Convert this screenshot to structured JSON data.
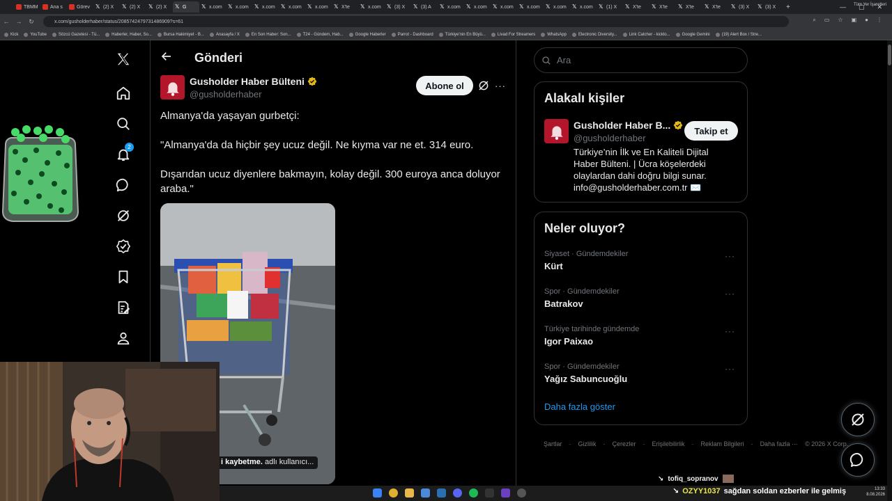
{
  "browser": {
    "tabs": [
      {
        "label": "TBMM",
        "fav": "red"
      },
      {
        "label": "Ana s",
        "fav": "red"
      },
      {
        "label": "Görev",
        "fav": "red"
      },
      {
        "label": "(2) X",
        "fav": "x"
      },
      {
        "label": "(2) X",
        "fav": "x"
      },
      {
        "label": "(2) X",
        "fav": "x"
      },
      {
        "label": "G",
        "fav": "x",
        "active": true
      },
      {
        "label": "x.com",
        "fav": "x"
      },
      {
        "label": "x.com",
        "fav": "x"
      },
      {
        "label": "x.com",
        "fav": "x"
      },
      {
        "label": "x.com",
        "fav": "x"
      },
      {
        "label": "x.com",
        "fav": "x"
      },
      {
        "label": "X'te",
        "fav": "x"
      },
      {
        "label": "x.com",
        "fav": "x"
      },
      {
        "label": "(3) X",
        "fav": "x"
      },
      {
        "label": "(3) A",
        "fav": "x"
      },
      {
        "label": "x.com",
        "fav": "x"
      },
      {
        "label": "x.com",
        "fav": "x"
      },
      {
        "label": "x.com",
        "fav": "x"
      },
      {
        "label": "x.com",
        "fav": "x"
      },
      {
        "label": "x.com",
        "fav": "x"
      },
      {
        "label": "x.com",
        "fav": "x"
      },
      {
        "label": "(1) X",
        "fav": "x"
      },
      {
        "label": "X'te",
        "fav": "x"
      },
      {
        "label": "X'te",
        "fav": "x"
      },
      {
        "label": "X'te",
        "fav": "x"
      },
      {
        "label": "X'te",
        "fav": "x"
      },
      {
        "label": "(3) X",
        "fav": "x"
      },
      {
        "label": "(3) X",
        "fav": "x"
      }
    ],
    "new_tab": "+",
    "url": "x.com/gusholderhaber/status/2085742479731486909?s=61",
    "bookmarks": [
      "Kick",
      "YouTube",
      "Sözcü Gazetesi - Tü...",
      "Haberler, Haber, So...",
      "Bursa Hakimiyet - B...",
      "Anasayfa / X",
      "En Son Haber: Son...",
      "T24 - Gündem, Hab...",
      "Google Haberler",
      "Parrot - Dashboard",
      "Türkiye'nin En Büyü...",
      "Livad For Streamers",
      "WhatsApp",
      "Electronic Diversity...",
      "Link Catcher - kicklo...",
      "Google Gemini",
      "(19) Alert Box / Stre..."
    ],
    "bookmarks_other": "Tüm Yer İşaretleri"
  },
  "nav": {
    "notifications_badge": "2"
  },
  "header": {
    "title": "Gönderi"
  },
  "tweet": {
    "author_name": "Gusholder Haber Bülteni",
    "author_handle": "@gusholderhaber",
    "subscribe_label": "Abone ol",
    "paragraphs": [
      "Almanya'da yaşayan gurbetçi:",
      "\"Almanya'da da hiçbir şey ucuz değil. Ne kıyma var ne et. 314 euro.",
      "Dışarıdan ucuz diyenlere bakmayın, kolay değil. 300 euroya anca doluyor araba.\""
    ],
    "media_caption_bold": "i kaybetme.",
    "media_caption_rest": " adlı kullanıcı..."
  },
  "search": {
    "placeholder": "Ara"
  },
  "related": {
    "title": "Alakalı kişiler",
    "name": "Gusholder Haber B...",
    "handle": "@gusholderhaber",
    "follow_label": "Takip et",
    "bio": "Türkiye’nin İlk ve En Kaliteli Dijital Haber Bülteni. | Ücra köşelerdeki olaylardan dahi doğru bilgi sunar. info@gusholderhaber.com.tr ✉️"
  },
  "trends": {
    "title": "Neler oluyor?",
    "items": [
      {
        "context": "Siyaset · Gündemdekiler",
        "name": "Kürt"
      },
      {
        "context": "Spor · Gündemdekiler",
        "name": "Batrakov"
      },
      {
        "context": "Türkiye tarihinde gündemde",
        "name": "Igor Paixao"
      },
      {
        "context": "Spor · Gündemdekiler",
        "name": "Yağız Sabuncuoğlu"
      }
    ],
    "show_more": "Daha fazla göster"
  },
  "footer": {
    "links": [
      "Şartlar",
      "·",
      "Gizlilik",
      "·",
      "Çerezler",
      "·",
      "Erişilebilirlik",
      "·",
      "Reklam Bilgileri",
      "·",
      "Daha fazla ···",
      "© 2026 X Corp."
    ]
  },
  "chat": {
    "line1_user": "tofiq_sopranov",
    "line2_user": "OZYY1037",
    "line2_text": "sağdan soldan ezberler ile gelmiş"
  },
  "clock": {
    "time": "13:33",
    "date": "8.08.2026"
  },
  "colors": {
    "accent": "#1d9bf0",
    "brand_red": "#b3162b",
    "verified_gold": "#e2b719"
  }
}
